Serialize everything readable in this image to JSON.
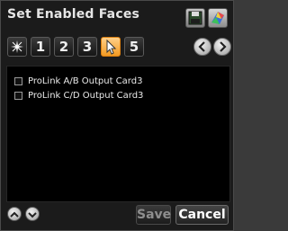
{
  "dialog": {
    "title": "Set Enabled Faces"
  },
  "toolbar": {
    "save_icon": "floppy-icon",
    "palette_icon": "palette-icon"
  },
  "faces": [
    {
      "label": "",
      "icon": "sparkle-icon",
      "selected": false
    },
    {
      "label": "1",
      "selected": false
    },
    {
      "label": "2",
      "selected": false
    },
    {
      "label": "3",
      "selected": false
    },
    {
      "label": "",
      "icon": "cursor-icon",
      "selected": true
    },
    {
      "label": "5",
      "selected": false
    }
  ],
  "nav": {
    "prev_icon": "chevron-left-icon",
    "next_icon": "chevron-right-icon"
  },
  "items": [
    {
      "label": "ProLink A/B Output Card3",
      "checked": false
    },
    {
      "label": "ProLink C/D Output Card3",
      "checked": false
    }
  ],
  "footer": {
    "up_icon": "chevron-up-icon",
    "down_icon": "chevron-down-icon",
    "save_label": "Save",
    "cancel_label": "Cancel"
  },
  "colors": {
    "accent": "#f39a22",
    "background": "#000000"
  }
}
